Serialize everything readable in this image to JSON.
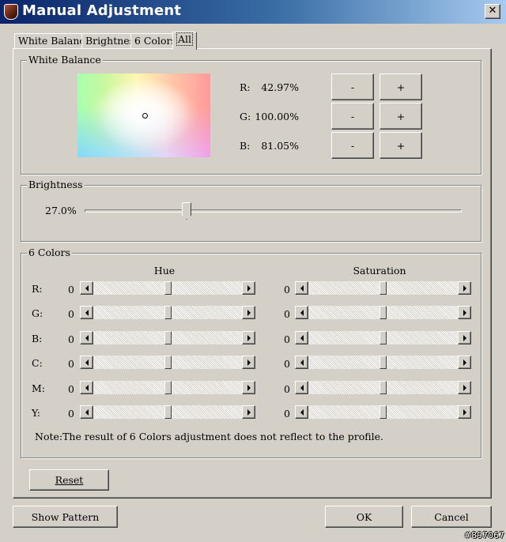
{
  "window": {
    "title": "Manual Adjustment",
    "close_glyph": "✕",
    "icon": "app-icon"
  },
  "tabs": [
    {
      "label": "White Balance",
      "active": false
    },
    {
      "label": "Brightness",
      "active": false
    },
    {
      "label": "6 Colors",
      "active": false
    },
    {
      "label": "All",
      "active": true
    }
  ],
  "white_balance": {
    "group_label": "White Balance",
    "channels": [
      {
        "label": "R:",
        "value": "42.97%"
      },
      {
        "label": "G:",
        "value": "100.00%"
      },
      {
        "label": "B:",
        "value": "81.05%"
      }
    ],
    "minus_label": "-",
    "plus_label": "+"
  },
  "brightness": {
    "group_label": "Brightness",
    "value": "27.0%",
    "level": 0.27
  },
  "six_colors": {
    "group_label": "6 Colors",
    "hue_header": "Hue",
    "saturation_header": "Saturation",
    "rows": [
      {
        "label": "R:",
        "hue": "0",
        "saturation": "0"
      },
      {
        "label": "G:",
        "hue": "0",
        "saturation": "0"
      },
      {
        "label": "B:",
        "hue": "0",
        "saturation": "0"
      },
      {
        "label": "C:",
        "hue": "0",
        "saturation": "0"
      },
      {
        "label": "M:",
        "hue": "0",
        "saturation": "0"
      },
      {
        "label": "Y:",
        "hue": "0",
        "saturation": "0"
      }
    ],
    "note": "Note:The result of 6 Colors adjustment does not reflect to the profile."
  },
  "buttons": {
    "reset": "Reset",
    "show_pattern": "Show Pattern",
    "ok": "OK",
    "cancel": "Cancel"
  },
  "watermark": "#897067"
}
